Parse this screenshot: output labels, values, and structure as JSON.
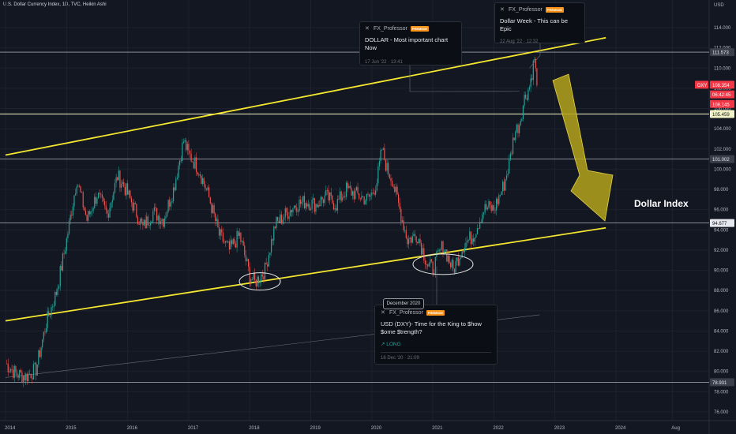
{
  "header": {
    "title": "U.S. Dollar Currency Index, 1D, TVC, Heikin Ashi",
    "currency": "USD"
  },
  "colors": {
    "bg": "#131722",
    "up": "#26a69a",
    "down": "#ef5350",
    "channel": "#f5e72f",
    "arrow": "#b5a31b",
    "grid": "#1e222d"
  },
  "chart_data": {
    "type": "candlestick",
    "title": "Dollar Index",
    "ylim": [
      75,
      116
    ],
    "x_tick_labels": [
      "2014",
      "2015",
      "2016",
      "2017",
      "2018",
      "2019",
      "2020",
      "2021",
      "2022",
      "2023",
      "2024",
      "Aug"
    ],
    "y_tick_labels": [
      "76.000",
      "78.000",
      "80.000",
      "82.000",
      "84.000",
      "86.000",
      "88.000",
      "90.000",
      "92.000",
      "94.000",
      "96.000",
      "98.000",
      "100.000",
      "102.000",
      "104.000",
      "106.000",
      "108.000",
      "110.000",
      "112.000",
      "114.000"
    ],
    "price_labels": [
      {
        "value": "111.573",
        "kind": "level"
      },
      {
        "value": "108.354",
        "kind": "last"
      },
      {
        "value": "06:42:45",
        "kind": "countdown"
      },
      {
        "value": "108.145",
        "kind": "last2"
      },
      {
        "value": "105.459",
        "kind": "level"
      },
      {
        "value": "101.002",
        "kind": "level"
      },
      {
        "value": "94.677",
        "kind": "level"
      },
      {
        "value": "78.931",
        "kind": "level"
      }
    ],
    "symbol_badge": "DXY",
    "horizontal_levels": [
      111.573,
      105.459,
      101.002,
      94.677,
      78.931
    ],
    "channel": {
      "upper": {
        "from": [
          "2014-01",
          101.4
        ],
        "to": [
          "2023-11",
          113.0
        ]
      },
      "lower": {
        "from": [
          "2014-01",
          85.0
        ],
        "to": [
          "2023-11",
          94.2
        ]
      }
    },
    "price_path": [
      [
        "2014-01",
        80.8
      ],
      [
        "2014-03",
        79.8
      ],
      [
        "2014-05",
        79.5
      ],
      [
        "2014-07",
        80.2
      ],
      [
        "2014-09",
        84.8
      ],
      [
        "2014-11",
        87.8
      ],
      [
        "2015-01",
        93.0
      ],
      [
        "2015-03",
        99.0
      ],
      [
        "2015-05",
        95.0
      ],
      [
        "2015-07",
        97.5
      ],
      [
        "2015-09",
        95.5
      ],
      [
        "2015-11",
        99.3
      ],
      [
        "2015-12",
        98.6
      ],
      [
        "2016-02",
        96.5
      ],
      [
        "2016-04",
        94.2
      ],
      [
        "2016-06",
        95.8
      ],
      [
        "2016-08",
        95.0
      ],
      [
        "2016-10",
        98.0
      ],
      [
        "2016-12",
        102.8
      ],
      [
        "2017-01",
        101.5
      ],
      [
        "2017-03",
        100.0
      ],
      [
        "2017-05",
        97.2
      ],
      [
        "2017-07",
        93.5
      ],
      [
        "2017-09",
        92.0
      ],
      [
        "2017-11",
        93.5
      ],
      [
        "2018-01",
        89.5
      ],
      [
        "2018-02",
        88.8
      ],
      [
        "2018-04",
        90.0
      ],
      [
        "2018-06",
        94.5
      ],
      [
        "2018-08",
        95.5
      ],
      [
        "2018-10",
        96.5
      ],
      [
        "2018-12",
        96.8
      ],
      [
        "2019-02",
        96.5
      ],
      [
        "2019-04",
        97.3
      ],
      [
        "2019-06",
        96.5
      ],
      [
        "2019-08",
        98.0
      ],
      [
        "2019-10",
        97.5
      ],
      [
        "2019-12",
        97.0
      ],
      [
        "2020-01",
        97.5
      ],
      [
        "2020-02",
        98.8
      ],
      [
        "2020-03",
        102.0
      ],
      [
        "2020-04",
        100.0
      ],
      [
        "2020-05",
        99.0
      ],
      [
        "2020-06",
        97.0
      ],
      [
        "2020-08",
        93.0
      ],
      [
        "2020-10",
        93.5
      ],
      [
        "2020-12",
        90.5
      ],
      [
        "2021-01",
        90.2
      ],
      [
        "2021-03",
        92.5
      ],
      [
        "2021-05",
        90.0
      ],
      [
        "2021-07",
        92.5
      ],
      [
        "2021-09",
        93.5
      ],
      [
        "2021-11",
        96.0
      ],
      [
        "2021-12",
        96.2
      ],
      [
        "2022-01",
        96.0
      ],
      [
        "2022-03",
        98.5
      ],
      [
        "2022-04",
        100.5
      ],
      [
        "2022-05",
        103.5
      ],
      [
        "2022-06",
        104.5
      ],
      [
        "2022-07",
        107.0
      ],
      [
        "2022-08",
        108.2
      ],
      [
        "2022-09",
        111.0
      ],
      [
        "2022-09-15",
        108.3
      ]
    ],
    "annotations": [
      {
        "text": "Dollar Index",
        "kind": "label"
      },
      {
        "text": "December 2020",
        "kind": "callout"
      }
    ]
  },
  "ideas": [
    {
      "author": "FX_Professor",
      "badge": "PREMIUM",
      "title": "DOLLAR - Most important chart Now",
      "date": "17 Jun '22 · 13:41",
      "signal": ""
    },
    {
      "author": "FX_Professor",
      "badge": "PREMIUM",
      "title": "Dollar Week - This can be Epic",
      "date": "22 Aug '22 · 12:32",
      "signal": ""
    },
    {
      "author": "FX_Professor",
      "badge": "PREMIUM",
      "title": "USD (DXY)- Time for the King to $how $ome $trength?",
      "date": "16 Dec '20 · 21:09",
      "signal": "↗ LONG"
    }
  ]
}
